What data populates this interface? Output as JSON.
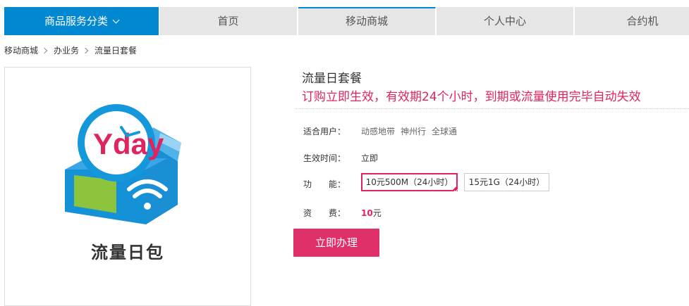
{
  "nav": {
    "category": "商品服务分类",
    "home": "首页",
    "mall": "移动商城",
    "user_center": "个人中心",
    "contract": "合约机"
  },
  "breadcrumb": [
    "移动商城",
    "办业务",
    "流量日套餐"
  ],
  "product": {
    "image_caption": "流量日包",
    "image_logo_text": "Yday",
    "title": "流量日套餐",
    "subtitle": "订购立即生效，有效期24个小时，到期或流量使用完毕自动失效",
    "users_label": "适合用户：",
    "users": [
      "动感地带",
      "神州行",
      "全球通"
    ],
    "effective_label": "生效时间：",
    "effective_value": "立即",
    "function_label": "功　　能：",
    "options": [
      "10元500M（24小时）",
      "15元1G（24小时）"
    ],
    "selected_option": "10元500M（24小时）",
    "fee_label": "资　　费：",
    "fee_amount": "10",
    "fee_unit": "元",
    "buy_button": "立即办理"
  },
  "colors": {
    "brand_blue": "#0288d1",
    "accent_pink": "#e0245e",
    "nav_gray": "#e6e6e6"
  }
}
